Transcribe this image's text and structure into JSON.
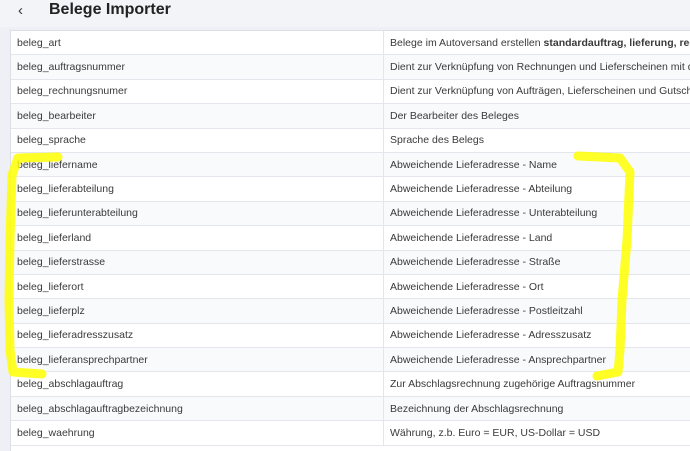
{
  "header": {
    "title": "Belege Importer",
    "back_icon": "chevron-left-icon"
  },
  "rows": [
    {
      "field": "beleg_art",
      "desc_pre": "Belege im Autoversand erstellen ",
      "desc_bold": "standardauftrag, lieferung, rechnu"
    },
    {
      "field": "beleg_auftragsnummer",
      "desc_pre": "Dient zur Verknüpfung von Rechnungen und Lieferscheinen mit dem",
      "desc_bold": ""
    },
    {
      "field": "beleg_rechnungsnumer",
      "desc_pre": "Dient zur Verknüpfung von Aufträgen, Lieferscheinen und Gutschrift",
      "desc_bold": ""
    },
    {
      "field": "beleg_bearbeiter",
      "desc_pre": "Der Bearbeiter des Beleges",
      "desc_bold": ""
    },
    {
      "field": "beleg_sprache",
      "desc_pre": "Sprache des Belegs",
      "desc_bold": ""
    },
    {
      "field": "beleg_liefername",
      "desc_pre": "Abweichende Lieferadresse - Name",
      "desc_bold": ""
    },
    {
      "field": "beleg_lieferabteilung",
      "desc_pre": "Abweichende Lieferadresse - Abteilung",
      "desc_bold": ""
    },
    {
      "field": "beleg_lieferunterabteilung",
      "desc_pre": "Abweichende Lieferadresse - Unterabteilung",
      "desc_bold": ""
    },
    {
      "field": "beleg_lieferland",
      "desc_pre": "Abweichende Lieferadresse - Land",
      "desc_bold": ""
    },
    {
      "field": "beleg_lieferstrasse",
      "desc_pre": "Abweichende Lieferadresse - Straße",
      "desc_bold": ""
    },
    {
      "field": "beleg_lieferort",
      "desc_pre": "Abweichende Lieferadresse - Ort",
      "desc_bold": ""
    },
    {
      "field": "beleg_lieferplz",
      "desc_pre": "Abweichende Lieferadresse - Postleitzahl",
      "desc_bold": ""
    },
    {
      "field": "beleg_lieferadresszusatz",
      "desc_pre": "Abweichende Lieferadresse - Adresszusatz",
      "desc_bold": ""
    },
    {
      "field": "beleg_lieferansprechpartner",
      "desc_pre": "Abweichende Lieferadresse - Ansprechpartner",
      "desc_bold": ""
    },
    {
      "field": "beleg_abschlagauftrag",
      "desc_pre": "Zur Abschlagsrechnung zugehörige Auftragsnummer",
      "desc_bold": ""
    },
    {
      "field": "beleg_abschlagauftragbezeichnung",
      "desc_pre": "Bezeichnung der Abschlagsrechnung",
      "desc_bold": ""
    },
    {
      "field": "beleg_waehrung",
      "desc_pre": "Währung, z.b. Euro = EUR, US-Dollar = USD",
      "desc_bold": ""
    }
  ],
  "colors": {
    "highlighter": "#ffff00",
    "header_bg": "#f2f4f8"
  }
}
